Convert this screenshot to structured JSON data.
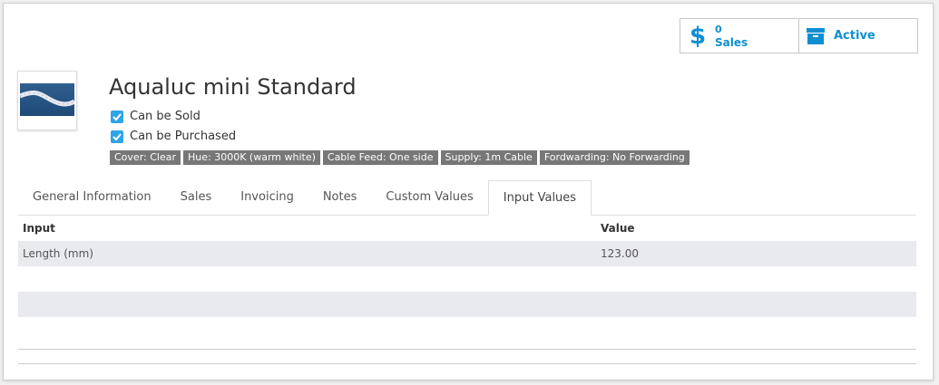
{
  "stats": {
    "sales_count": "0",
    "sales_label": "Sales",
    "active_label": "Active"
  },
  "product": {
    "title": "Aqualuc mini Standard",
    "can_be_sold": "Can be Sold",
    "can_be_purchased": "Can be Purchased",
    "tags": [
      "Cover: Clear",
      "Hue: 3000K (warm white)",
      "Cable Feed: One side",
      "Supply: 1m Cable",
      "Fordwarding: No Forwarding"
    ]
  },
  "tabs": [
    "General Information",
    "Sales",
    "Invoicing",
    "Notes",
    "Custom Values",
    "Input Values"
  ],
  "active_tab": "Input Values",
  "table": {
    "headers": [
      "Input",
      "Value"
    ],
    "rows": [
      [
        "Length (mm)",
        "123.00"
      ]
    ]
  },
  "colors": {
    "accent": "#0f8fd2",
    "checkbox": "#2fa4e7",
    "tag_bg": "#777777",
    "stripe": "#e9e9f0"
  },
  "icons": [
    "dollar-icon",
    "archive-icon",
    "checkmark-icon"
  ]
}
